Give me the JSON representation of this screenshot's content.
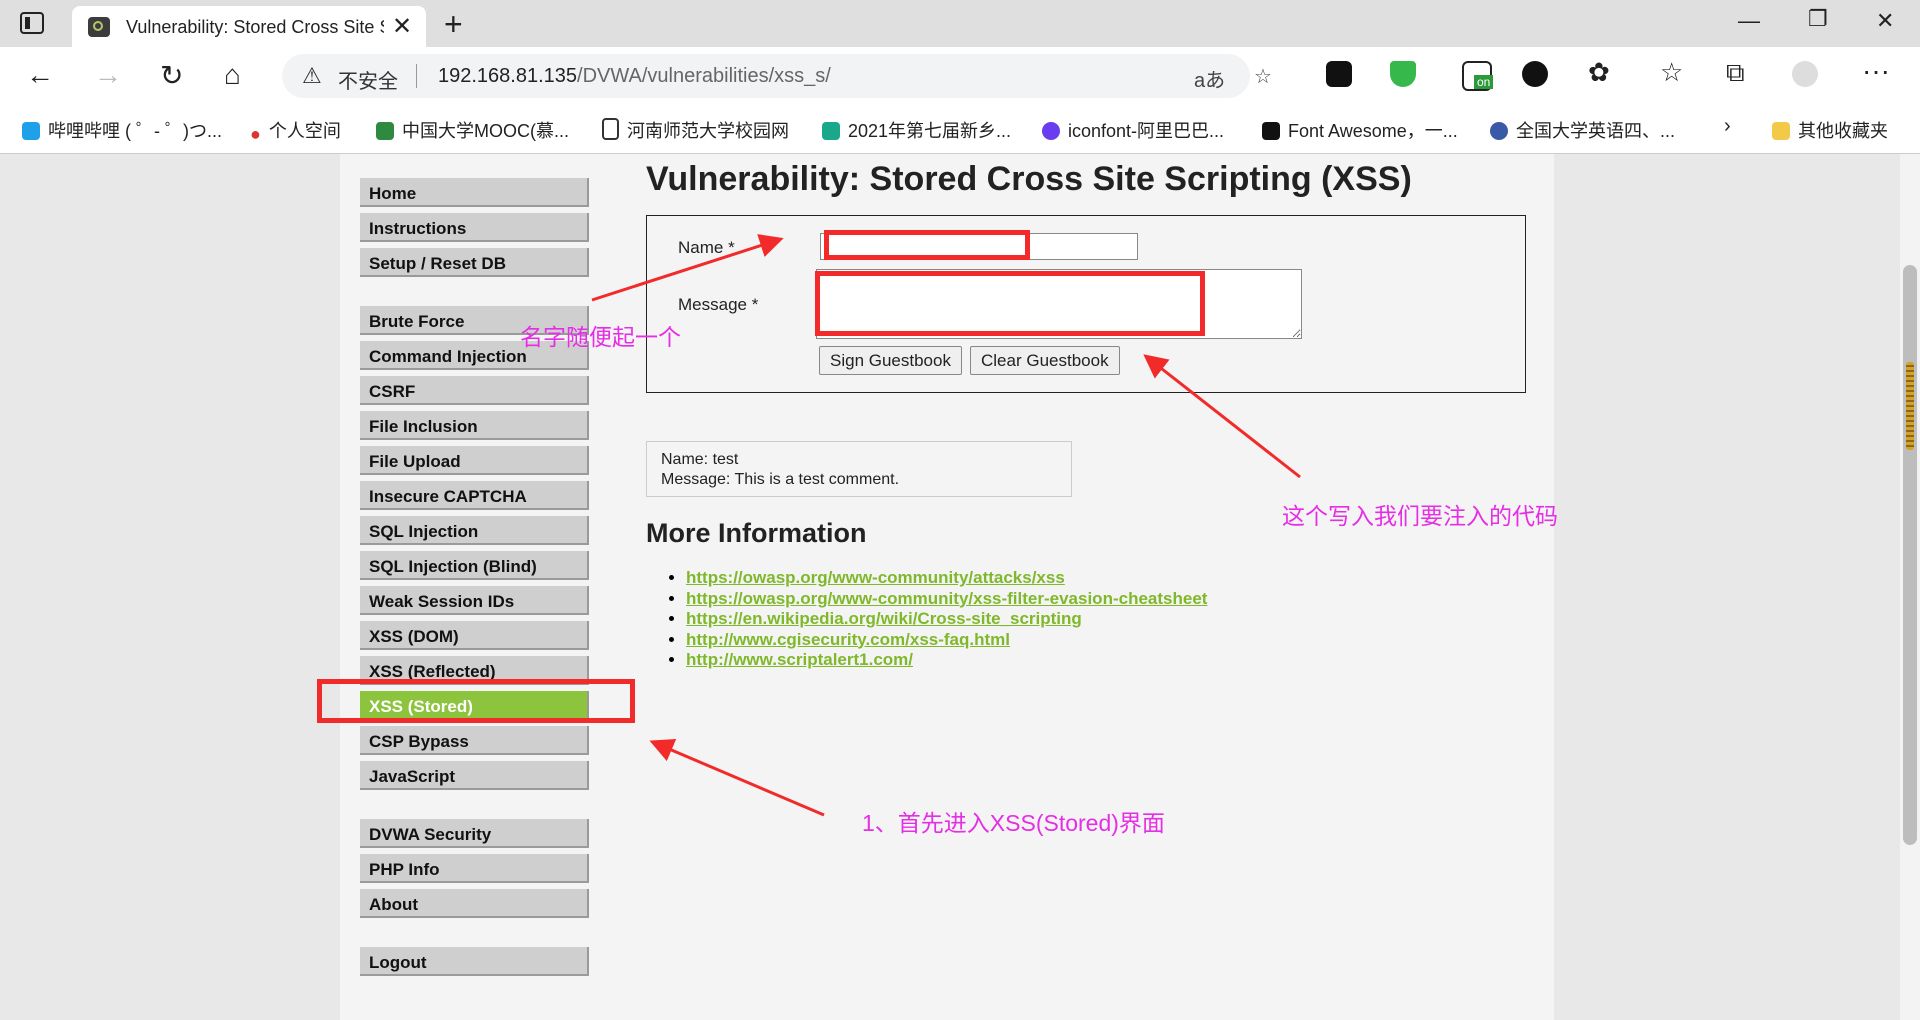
{
  "browser": {
    "tab_title": "Vulnerability: Stored Cross Site Sc",
    "insecure_label": "不安全",
    "url_host": "192.168.81.135",
    "url_path": "/DVWA/vulnerabilities/xss_s/",
    "ext_badge": "on",
    "bookmarks": [
      "哔哩哔哩 ( ゜- ゜)つ...",
      "个人空间",
      "中国大学MOOC(慕...",
      "河南师范大学校园网",
      "2021年第七届新乡...",
      "iconfont-阿里巴巴...",
      "Font Awesome，一...",
      "全国大学英语四、...",
      "其他收藏夹"
    ]
  },
  "menu": {
    "items": [
      "Home",
      "Instructions",
      "Setup / Reset DB",
      "Brute Force",
      "Command Injection",
      "CSRF",
      "File Inclusion",
      "File Upload",
      "Insecure CAPTCHA",
      "SQL Injection",
      "SQL Injection (Blind)",
      "Weak Session IDs",
      "XSS (DOM)",
      "XSS (Reflected)",
      "XSS (Stored)",
      "CSP Bypass",
      "JavaScript",
      "DVWA Security",
      "PHP Info",
      "About",
      "Logout"
    ],
    "active": "XSS (Stored)"
  },
  "main": {
    "title": "Vulnerability: Stored Cross Site Scripting (XSS)",
    "name_label": "Name *",
    "message_label": "Message *",
    "name_value": "",
    "message_value": "",
    "sign_button": "Sign Guestbook",
    "clear_button": "Clear Guestbook",
    "entry_name": "Name: test",
    "entry_message": "Message: This is a test comment.",
    "more_info_heading": "More Information",
    "links": [
      "https://owasp.org/www-community/attacks/xss",
      "https://owasp.org/www-community/xss-filter-evasion-cheatsheet",
      "https://en.wikipedia.org/wiki/Cross-site_scripting",
      "http://www.cgisecurity.com/xss-faq.html",
      "http://www.scriptalert1.com/"
    ]
  },
  "annotations": {
    "name_hint": "名字随便起一个",
    "message_hint": "这个写入我们要注入的代码",
    "step_hint": "1、首先进入XSS(Stored)界面"
  },
  "colors": {
    "menu_active": "#8cc43e",
    "link": "#7fb82a",
    "annotation_text": "#e52ee5",
    "annotation_box": "#f22a2a"
  }
}
